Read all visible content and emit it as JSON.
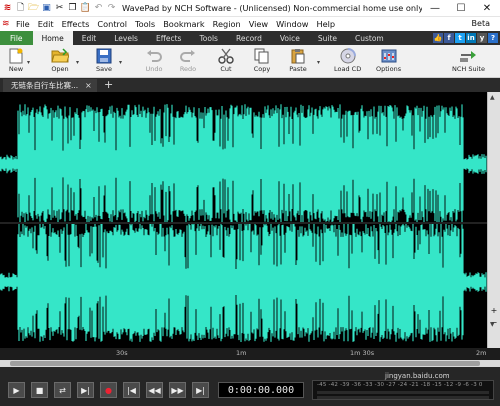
{
  "app": {
    "title": "WavePad by NCH Software - (Unlicensed) Non-commercial home use only - (无..."
  },
  "window_controls": {
    "minimize": "—",
    "maximize": "☐",
    "close": "✕"
  },
  "menu": {
    "items": [
      "File",
      "Edit",
      "Effects",
      "Control",
      "Tools",
      "Bookmark",
      "Region",
      "View",
      "Window",
      "Help"
    ],
    "beta": "Beta"
  },
  "ribbon": {
    "tabs": [
      "File",
      "Home",
      "Edit",
      "Levels",
      "Effects",
      "Tools",
      "Record",
      "Voice",
      "Suite",
      "Custom"
    ],
    "active_tab": "Home",
    "social": [
      "f",
      "t",
      "in",
      "y",
      "?"
    ]
  },
  "toolbar": {
    "new": "New",
    "open": "Open",
    "save": "Save",
    "undo": "Undo",
    "redo": "Redo",
    "cut": "Cut",
    "copy": "Copy",
    "paste": "Paste",
    "load_cd": "Load CD",
    "options": "Options",
    "nch_suite": "NCH Suite"
  },
  "document": {
    "tab_label": "无链条自行车比赛...",
    "close": "×",
    "add": "+"
  },
  "timeline": {
    "ticks": [
      "30s",
      "1m",
      "1m 30s",
      "2m"
    ]
  },
  "transport": {
    "time": "0:00:00.000",
    "meter_scale": "-45 -42 -39 -36 -33 -30 -27 -24 -21 -18 -15 -12 -9 -6 -3 0"
  },
  "watermark": "jingyan.baidu.com",
  "colors": {
    "waveform": "#35e6c8",
    "background": "#000000",
    "file_tab": "#3d8f3d",
    "ribbon_bar": "#2e2e2e"
  }
}
